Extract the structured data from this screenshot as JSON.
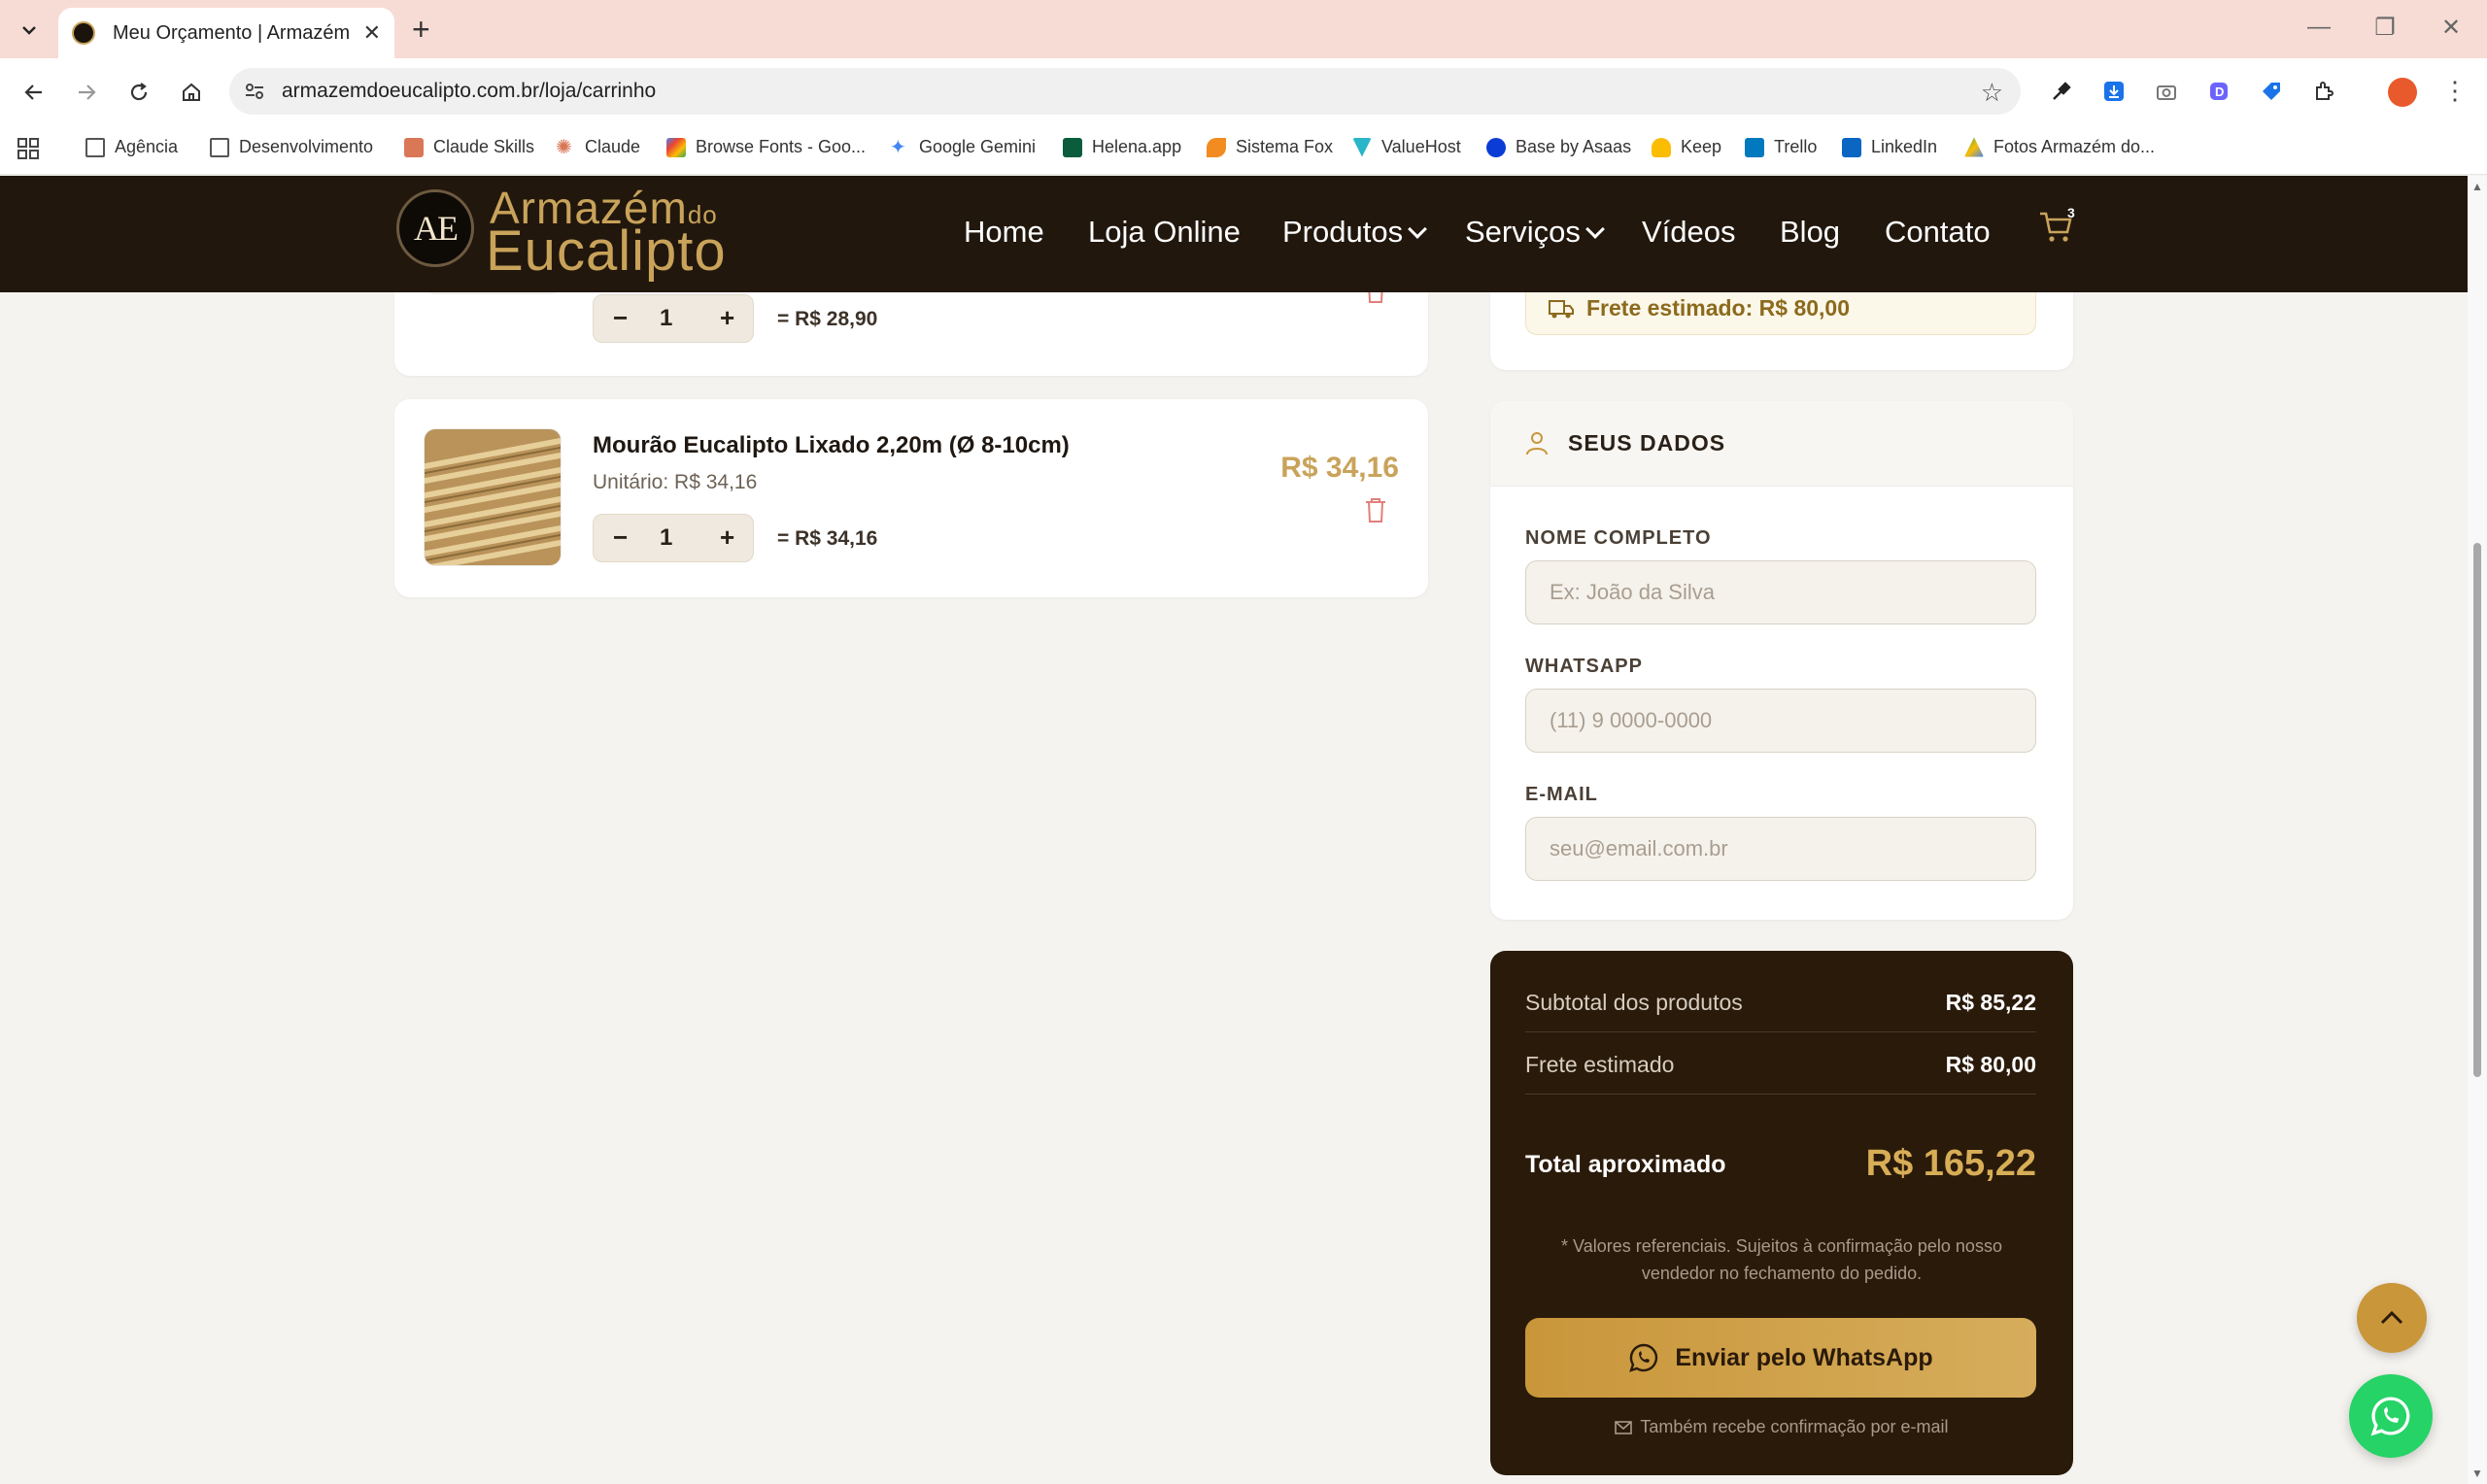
{
  "browser": {
    "tab_title": "Meu Orçamento | Armazém do Eucalipto",
    "url": "armazemdoeucalipto.com.br/loja/carrinho",
    "bookmarks": [
      {
        "label": "Agência"
      },
      {
        "label": "Desenvolvimento"
      },
      {
        "label": "Claude Skills"
      },
      {
        "label": "Claude"
      },
      {
        "label": "Browse Fonts - Goo..."
      },
      {
        "label": "Google Gemini"
      },
      {
        "label": "Helena.app"
      },
      {
        "label": "Sistema Fox"
      },
      {
        "label": "ValueHost"
      },
      {
        "label": "Base by Asaas"
      },
      {
        "label": "Keep"
      },
      {
        "label": "Trello"
      },
      {
        "label": "LinkedIn"
      },
      {
        "label": "Fotos Armazém do..."
      }
    ]
  },
  "header": {
    "logo_monogram": "AE",
    "logo_line1": "Armazém",
    "logo_do": "do",
    "logo_line2": "Eucalipto",
    "nav": [
      "Home",
      "Loja Online",
      "Produtos",
      "Serviços",
      "Vídeos",
      "Blog",
      "Contato"
    ],
    "cart_count": "3"
  },
  "cart": {
    "items": [
      {
        "quantity": "1",
        "line_total": "= R$ 28,90"
      },
      {
        "name": "Mourão Eucalipto Lixado 2,20m (Ø 8-10cm)",
        "unit_price": "Unitário: R$ 34,16",
        "price": "R$ 34,16",
        "quantity": "1",
        "line_total": "= R$ 34,16"
      }
    ],
    "qty_minus": "−",
    "qty_plus": "+"
  },
  "freight": {
    "estimate": "Frete estimado: R$ 80,00"
  },
  "form": {
    "section_title": "SEUS DADOS",
    "name_label": "NOME COMPLETO",
    "name_placeholder": "Ex: João da Silva",
    "whatsapp_label": "WHATSAPP",
    "whatsapp_placeholder": "(11) 9 0000-0000",
    "email_label": "E-MAIL",
    "email_placeholder": "seu@email.com.br"
  },
  "summary": {
    "subtotal_label": "Subtotal dos produtos",
    "subtotal_value": "R$ 85,22",
    "freight_label": "Frete estimado",
    "freight_value": "R$ 80,00",
    "total_label": "Total aproximado",
    "total_value": "R$ 165,22",
    "note": "* Valores referenciais. Sujeitos à confirmação pelo nosso vendedor no fechamento do pedido.",
    "button_label": "Enviar pelo WhatsApp",
    "email_note": "Também recebe confirmação por e-mail"
  },
  "colors": {
    "header_bg": "#21170d",
    "accent_gold": "#c9a35a",
    "summary_bg": "#2a1a0a",
    "whatsapp_green": "#25d366"
  }
}
